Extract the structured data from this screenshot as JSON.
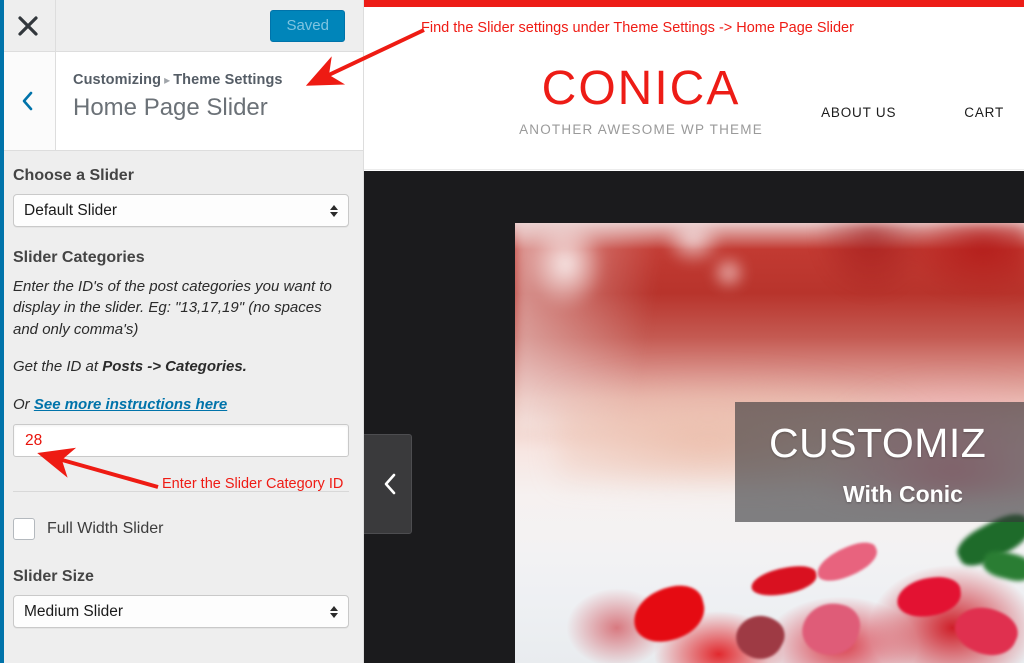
{
  "customizer": {
    "close_icon": "close-icon",
    "save_label": "Saved",
    "back_icon": "chevron-left-icon",
    "breadcrumb_root": "Customizing",
    "breadcrumb_sep": "▸",
    "breadcrumb_parent": "Theme Settings",
    "panel_title": "Home Page Slider",
    "controls": {
      "choose_slider_label": "Choose a Slider",
      "choose_slider_value": "Default Slider",
      "slider_categories_label": "Slider Categories",
      "desc_line_1": "Enter the ID's of the post categories you want to display in the slider. Eg: \"13,17,19\" (no spaces and only comma's)",
      "desc_line_2_prefix": "Get the ID at ",
      "desc_line_2_bold": "Posts -> Categories.",
      "desc_line_3_prefix": "Or ",
      "desc_line_3_link": "See more instructions here",
      "category_id_value": "28",
      "category_id_placeholder": "",
      "full_width_label": "Full Width Slider",
      "full_width_checked": false,
      "slider_size_label": "Slider Size",
      "slider_size_value": "Medium Slider"
    }
  },
  "preview": {
    "site_title": "CONICA",
    "site_tagline": "ANOTHER AWESOME WP THEME",
    "nav": [
      {
        "label": "ABOUT US"
      },
      {
        "label": "CART"
      }
    ],
    "slide": {
      "title": "CUSTOMIZ",
      "subtitle": "With Conic"
    },
    "prev_arrow_icon": "chevron-left-icon"
  },
  "annotations": {
    "top_note": "Find the Slider settings under Theme Settings -> Home Page Slider",
    "input_note": "Enter the Slider Category ID"
  },
  "colors": {
    "brand_red": "#ed1c16",
    "annotation_red": "#ef1b14",
    "wp_blue": "#0085ba",
    "wp_blue_accent": "#0073aa",
    "sidebar_bg": "#eeeeee",
    "stage_bg": "#1b1b1d"
  }
}
